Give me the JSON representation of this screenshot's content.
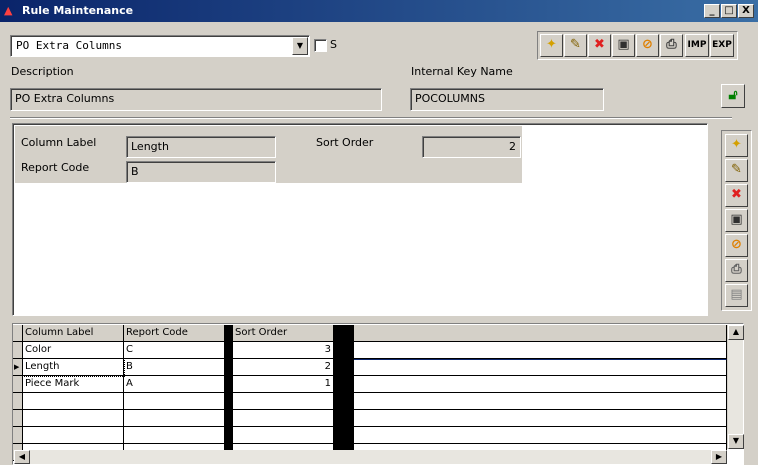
{
  "window": {
    "title": "Rule Maintenance",
    "buttons": {
      "minimize": "_",
      "maximize": "□",
      "close": "X"
    }
  },
  "rule_selector": {
    "value": "PO Extra Columns",
    "checkbox_label": "S",
    "checkbox_checked": false
  },
  "header_toolbar": {
    "buttons": [
      {
        "name": "new",
        "glyph": "✦",
        "color": "#d4a000"
      },
      {
        "name": "edit",
        "glyph": "✎",
        "color": "#806000"
      },
      {
        "name": "delete",
        "glyph": "✖",
        "color": "#e02020"
      },
      {
        "name": "save",
        "glyph": "▣",
        "color": "#303030"
      },
      {
        "name": "cancel",
        "glyph": "⊘",
        "color": "#e08000"
      },
      {
        "name": "print",
        "glyph": "⎙",
        "color": "#404040"
      }
    ],
    "imp_label": "IMP",
    "exp_label": "EXP"
  },
  "description": {
    "label": "Description",
    "value": "PO Extra Columns"
  },
  "internal_key": {
    "label": "Internal Key Name",
    "value": "POCOLUMNS"
  },
  "lock_icon": {
    "color": "#008000"
  },
  "detail": {
    "column_label": {
      "label": "Column Label",
      "value": "Length"
    },
    "report_code": {
      "label": "Report Code",
      "value": "B"
    },
    "sort_order": {
      "label": "Sort Order",
      "value": "2"
    }
  },
  "side_toolbar": {
    "buttons": [
      {
        "name": "new",
        "glyph": "✦",
        "color": "#d4a000"
      },
      {
        "name": "edit",
        "glyph": "✎",
        "color": "#806000"
      },
      {
        "name": "delete",
        "glyph": "✖",
        "color": "#e02020"
      },
      {
        "name": "save",
        "glyph": "▣",
        "color": "#303030"
      },
      {
        "name": "cancel",
        "glyph": "⊘",
        "color": "#e08000"
      },
      {
        "name": "print",
        "glyph": "⎙",
        "color": "#606060"
      },
      {
        "name": "paste",
        "glyph": "▤",
        "color": "#808080"
      }
    ]
  },
  "grid": {
    "columns": [
      "Column Label",
      "Report Code",
      "Sort Order"
    ],
    "rows": [
      {
        "label": "Color",
        "code": "C",
        "sort": "3"
      },
      {
        "label": "Length",
        "code": "B",
        "sort": "2",
        "current": true
      },
      {
        "label": "Piece Mark",
        "code": "A",
        "sort": "1"
      }
    ],
    "empty_rows": 4
  }
}
